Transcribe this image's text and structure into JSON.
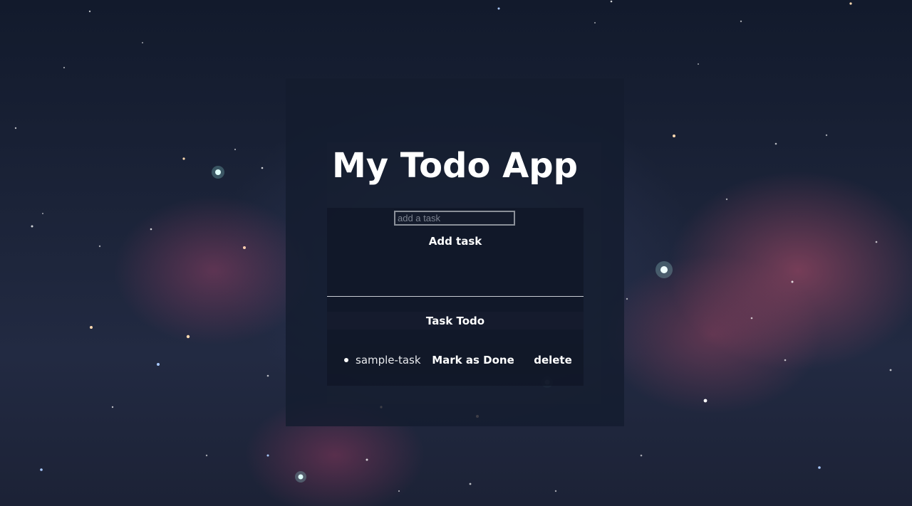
{
  "app": {
    "title": "My Todo App"
  },
  "form": {
    "input_placeholder": "add a task",
    "input_value": "",
    "add_label": "Add task"
  },
  "todo_section": {
    "title": "Task Todo",
    "tasks": [
      {
        "label": "sample-task",
        "done_label": "Mark as Done",
        "delete_label": "delete"
      }
    ]
  },
  "colors": {
    "text": "#ffffff",
    "card": "#141c2e",
    "panel": "#101626"
  }
}
